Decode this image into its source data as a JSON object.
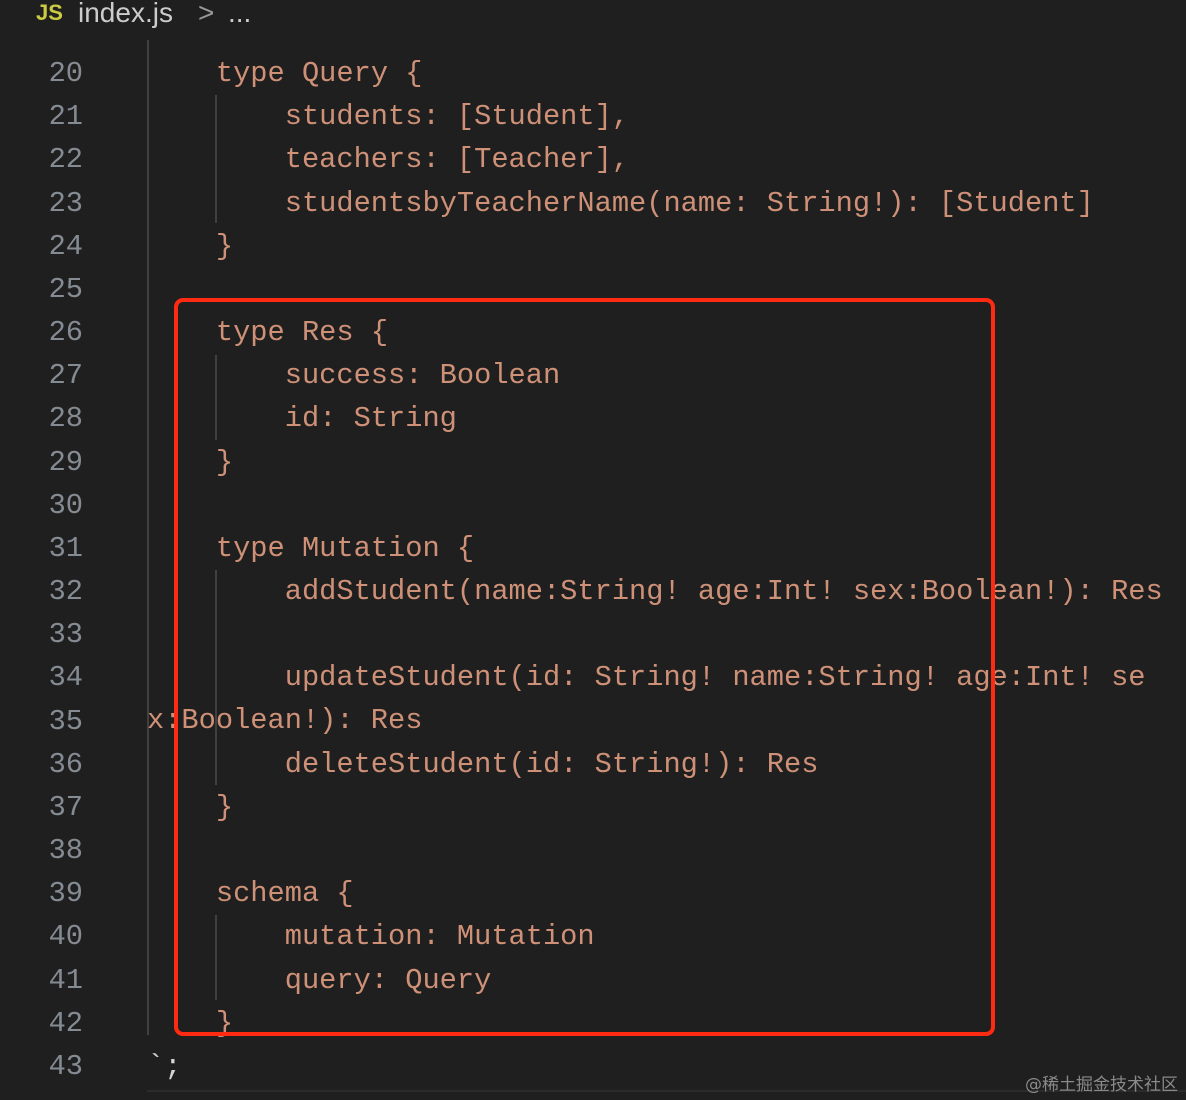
{
  "breadcrumb": {
    "file_icon": "JS",
    "file": "index.js",
    "separator": ">",
    "more": "..."
  },
  "lines": [
    {
      "n": "20",
      "code": "    type Query {"
    },
    {
      "n": "21",
      "code": "        students: [Student],"
    },
    {
      "n": "22",
      "code": "        teachers: [Teacher],"
    },
    {
      "n": "23",
      "code": "        studentsbyTeacherName(name: String!): [Student]"
    },
    {
      "n": "24",
      "code": "    }"
    },
    {
      "n": "25",
      "code": ""
    },
    {
      "n": "26",
      "code": "    type Res {"
    },
    {
      "n": "27",
      "code": "        success: Boolean"
    },
    {
      "n": "28",
      "code": "        id: String"
    },
    {
      "n": "29",
      "code": "    }"
    },
    {
      "n": "30",
      "code": ""
    },
    {
      "n": "31",
      "code": "    type Mutation {"
    },
    {
      "n": "32",
      "code": "        addStudent(name:String! age:Int! sex:Boolean!): Res"
    },
    {
      "n": "33",
      "code": ""
    },
    {
      "n": "34",
      "code": "        updateStudent(id: String! name:String! age:Int! sex:Boolean!): Res"
    },
    {
      "n": "35",
      "code": ""
    },
    {
      "n": "36",
      "code": "        deleteStudent(id: String!): Res"
    },
    {
      "n": "37",
      "code": "    }"
    },
    {
      "n": "38",
      "code": ""
    },
    {
      "n": "39",
      "code": "    schema {"
    },
    {
      "n": "40",
      "code": "        mutation: Mutation"
    },
    {
      "n": "41",
      "code": "        query: Query"
    },
    {
      "n": "42",
      "code": "    }"
    },
    {
      "n": "43",
      "code": "`;"
    }
  ],
  "watermark": "@稀土掘金技术社区",
  "colors": {
    "highlight_box": "#ff2a12",
    "code": "#ce9178",
    "background": "#1f1f1f"
  }
}
